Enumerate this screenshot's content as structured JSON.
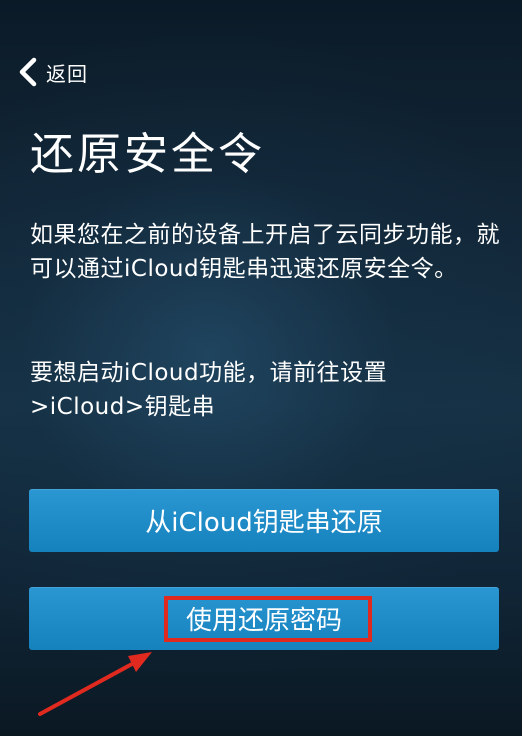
{
  "header": {
    "back_label": "返回"
  },
  "page": {
    "title": "还原安全令",
    "description_1": "如果您在之前的设备上开启了云同步功能，就可以通过iCloud钥匙串迅速还原安全令。",
    "description_2": "要想启动iCloud功能，请前往设置>iCloud>钥匙串"
  },
  "buttons": {
    "restore_icloud_label": "从iCloud钥匙串还原",
    "restore_password_label": "使用还原密码"
  },
  "colors": {
    "button_blue": "#1f8ccb",
    "highlight_red": "#e12a1f"
  },
  "icons": {
    "back": "chevron-left-icon",
    "annotation": "red-arrow-icon"
  }
}
